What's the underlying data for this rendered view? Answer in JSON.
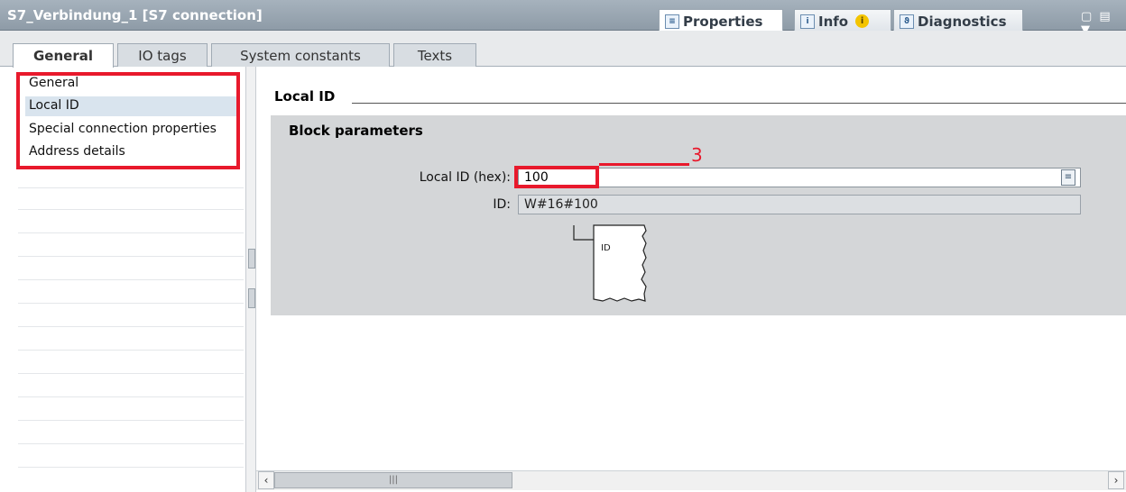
{
  "window": {
    "title": "S7_Verbindung_1 [S7 connection]",
    "top_tabs": [
      {
        "label": "Properties",
        "icon": "properties-icon"
      },
      {
        "label": "Info",
        "icon": "info-icon",
        "badge": "i"
      },
      {
        "label": "Diagnostics",
        "icon": "diagnostics-icon"
      }
    ],
    "window_controls": "▢ ▤ ▼"
  },
  "tabs": [
    "General",
    "IO tags",
    "System constants",
    "Texts"
  ],
  "nav": {
    "items": [
      "General",
      "Local ID",
      "Special connection properties",
      "Address details"
    ],
    "selected": "Local ID"
  },
  "main": {
    "section_title": "Local ID",
    "block_title": "Block parameters",
    "fields": {
      "local_id_label": "Local ID (hex):",
      "local_id_value": "100",
      "id_label": "ID:",
      "id_value": "W#16#100"
    },
    "diagram_label": "ID",
    "callout": "3"
  },
  "colors": {
    "accent_red": "#e8192c",
    "titlebar": "#9aa6b2",
    "panel": "#d4d6d8"
  }
}
